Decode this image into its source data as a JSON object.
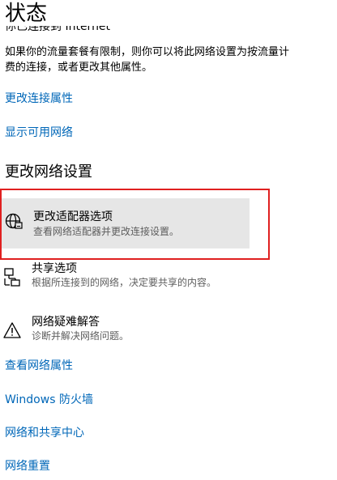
{
  "header": {
    "title": "状态",
    "clipped_line": "你已连接到 Internet"
  },
  "description": {
    "line1": "如果你的流量套餐有限制，则你可以将此网络设置为按流量计",
    "line2": "费的连接，或者更改其他属性。"
  },
  "links_top": {
    "change_connection_properties": "更改连接属性",
    "show_available_networks": "显示可用网络"
  },
  "section": {
    "heading": "更改网络设置"
  },
  "options": {
    "adapter": {
      "title": "更改适配器选项",
      "subtitle": "查看网络适配器并更改连接设置。"
    },
    "sharing": {
      "title": "共享选项",
      "subtitle": "根据所连接到的网络，决定要共享的内容。"
    },
    "troubleshoot": {
      "title": "网络疑难解答",
      "subtitle": "诊断并解决网络问题。"
    }
  },
  "links_bottom": {
    "view_network_properties": "查看网络属性",
    "windows_firewall": "Windows 防火墙",
    "network_sharing_center": "网络和共享中心",
    "network_reset": "网络重置"
  },
  "colors": {
    "link": "#0067b8",
    "highlight_bg": "#e6e6e6",
    "annotation_red": "#e02020"
  }
}
